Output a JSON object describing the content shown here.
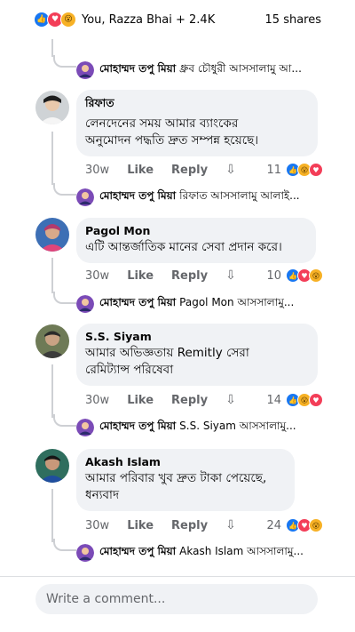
{
  "header": {
    "reactors": "You, Razza Bhai + 2.4K",
    "shares": "15 shares",
    "reaction_icons": [
      "like",
      "love",
      "wow"
    ]
  },
  "top_reply": {
    "author": "মোহাম্মদ তপু মিয়া",
    "text": "ধ্রুব চৌধুরী আসসালামু আ..."
  },
  "comments": [
    {
      "author": "রিফাত",
      "text_lines": [
        "লেনদেনের সময় আমার ব্যাংকের",
        "অনুমোদন পদ্ধতি দ্রুত সম্পন্ন হয়েছে।"
      ],
      "time": "30w",
      "like": "Like",
      "reply": "Reply",
      "count": "11",
      "reply_author": "মোহাম্মদ তপু মিয়া",
      "reply_text": "রিফাত আসসালামু আলাই..."
    },
    {
      "author": "Pagol Mon",
      "text_lines": [
        "এটি আন্তর্জাতিক মানের সেবা প্রদান করে।"
      ],
      "time": "30w",
      "like": "Like",
      "reply": "Reply",
      "count": "10",
      "reply_author": "মোহাম্মদ তপু মিয়া",
      "reply_text": "Pagol Mon আসসালামু..."
    },
    {
      "author": "S.S. Siyam",
      "text_lines": [
        "আমার অভিজ্ঞতায় Remitly সেরা",
        "রেমিট্যান্স পরিষেবা"
      ],
      "time": "30w",
      "like": "Like",
      "reply": "Reply",
      "count": "14",
      "reply_author": "মোহাম্মদ তপু মিয়া",
      "reply_text": "S.S. Siyam আসসালামু..."
    },
    {
      "author": "Akash Islam",
      "text_lines": [
        "আমার পরিবার খুব দ্রুত টাকা পেয়েছে,",
        "ধন্যবাদ"
      ],
      "time": "30w",
      "like": "Like",
      "reply": "Reply",
      "count": "24",
      "reply_author": "মোহাম্মদ তপু মিয়া",
      "reply_text": "Akash Islam আসসালামু..."
    }
  ],
  "composer": {
    "placeholder": "Write a comment..."
  },
  "colors": {
    "like": "#1877f2",
    "love": "#f33e58",
    "wow": "#f7b125",
    "bubble": "#f0f2f5",
    "meta": "#65676b"
  }
}
